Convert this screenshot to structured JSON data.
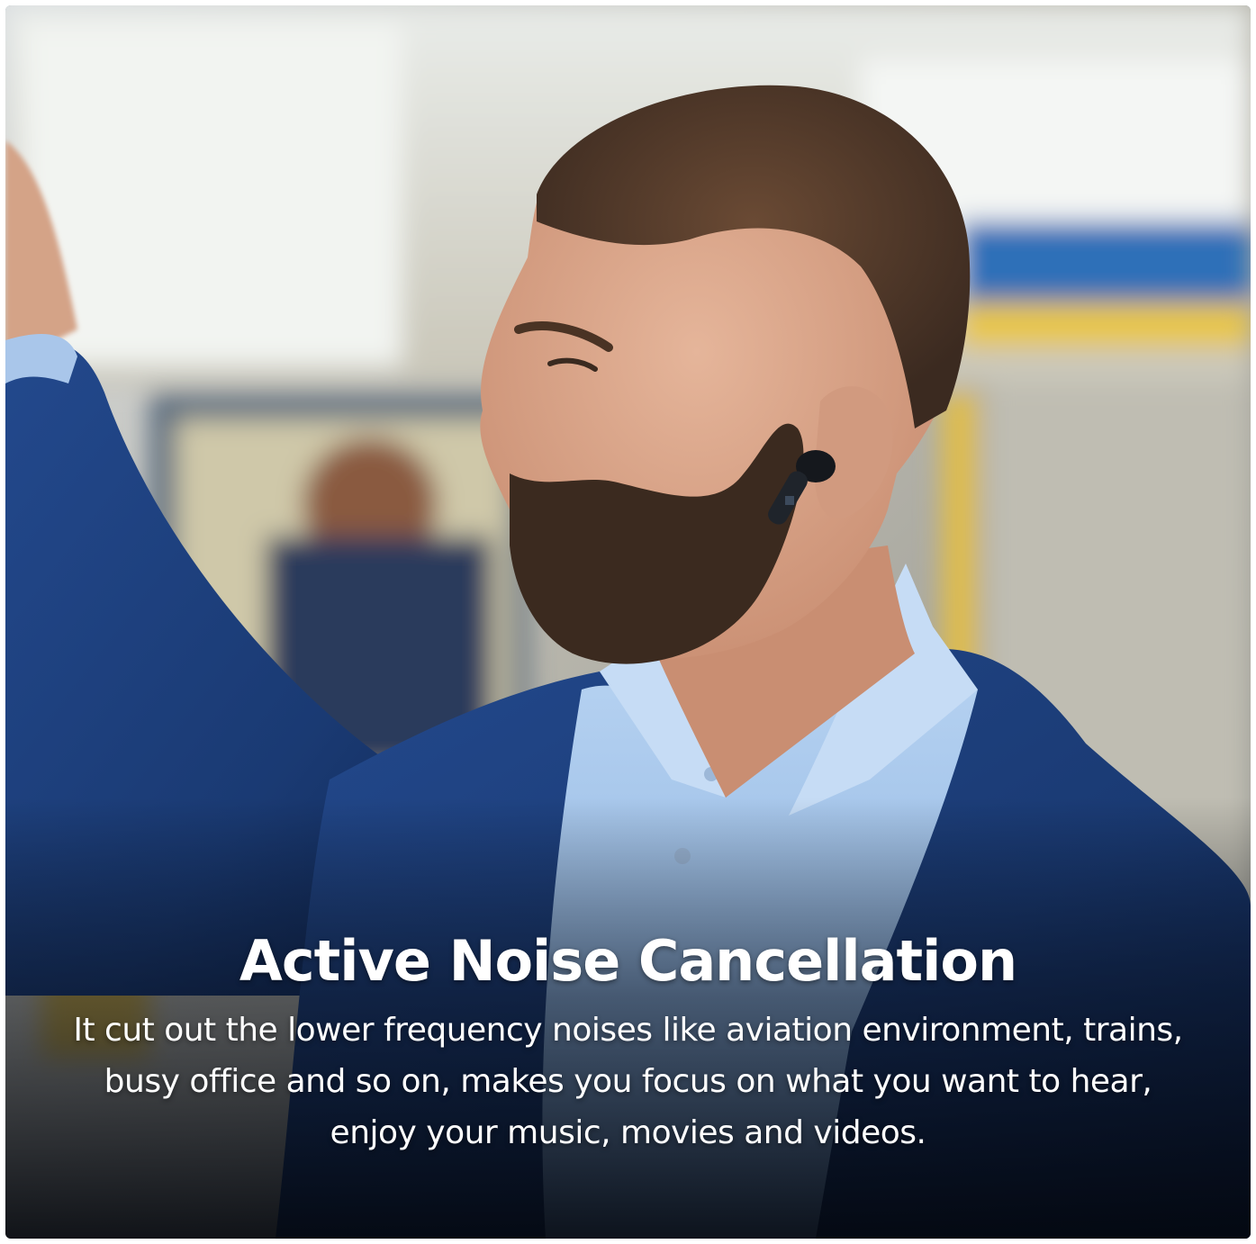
{
  "headline": "Active Noise Cancellation",
  "description": "It cut out the lower frequency noises like aviation environment, trains, busy office and so on, makes you focus on what you want to hear, enjoy your music, movies and videos.",
  "colors": {
    "jacket": "#1c3d78",
    "shirt": "#9fc3ec",
    "train_blue": "#2f6fb8",
    "train_yellow": "#e8c64a",
    "caption_overlay": "#0a1220",
    "earbud": "#15181d"
  }
}
